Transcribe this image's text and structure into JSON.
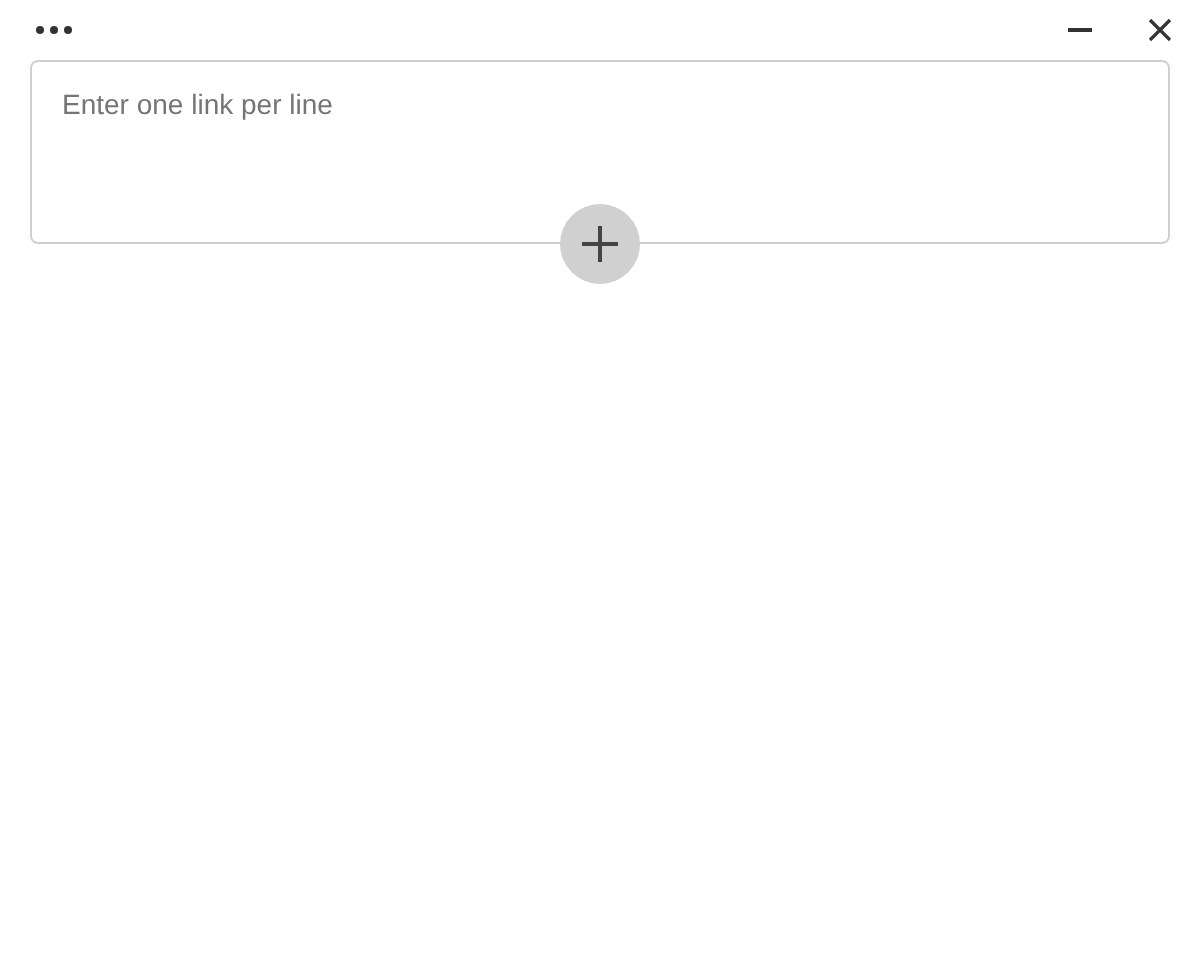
{
  "links_field": {
    "placeholder": "Enter one link per line"
  }
}
